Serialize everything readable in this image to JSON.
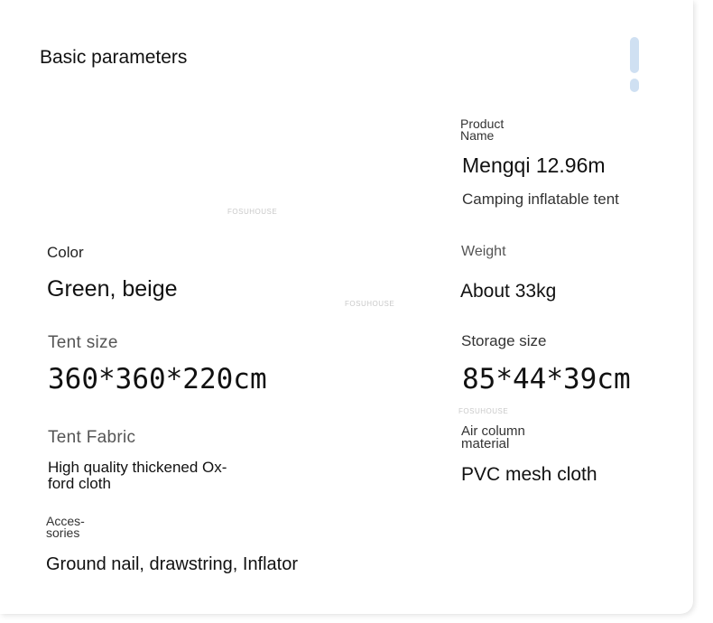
{
  "page": {
    "title": "Basic parameters",
    "watermark": "FOSUHOUSE"
  },
  "params": {
    "product_name": {
      "label_line1": "Product",
      "label_line2": "Name",
      "value": "Mengqi 12.96m",
      "subvalue": "Camping inflatable tent"
    },
    "color": {
      "label": "Color",
      "value": "Green, beige"
    },
    "weight": {
      "label": "Weight",
      "value": "About 33kg"
    },
    "tent_size": {
      "label": "Tent size",
      "value": "360*360*220cm"
    },
    "storage_size": {
      "label": "Storage size",
      "value": "85*44*39cm"
    },
    "tent_fabric": {
      "label": "Tent Fabric",
      "value_line1": "High quality thickened Ox-",
      "value_line2": "ford cloth"
    },
    "air_column": {
      "label_line1": "Air column",
      "label_line2": "material",
      "value": "PVC mesh cloth"
    },
    "accessories": {
      "label_line1": "Acces-",
      "label_line2": "sories",
      "value": "Ground nail, drawstring, Inflator"
    }
  },
  "colors": {
    "accent_pill": "#cfe0f2",
    "text_primary": "#111111",
    "text_label": "#555555"
  }
}
